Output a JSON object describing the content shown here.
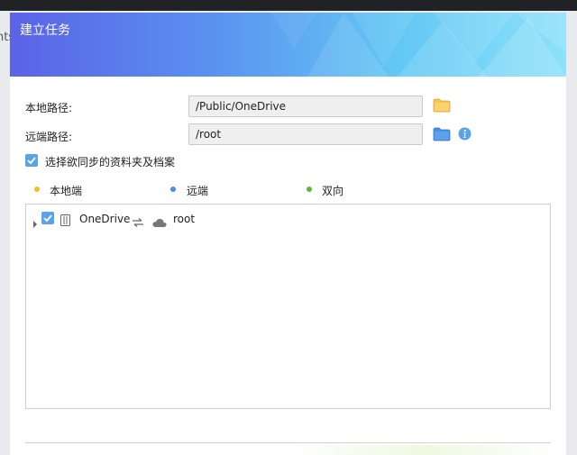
{
  "background": {
    "partial_text": "nts"
  },
  "dialog": {
    "title": "建立任务",
    "local_path": {
      "label": "本地路径:",
      "value": "/Public/OneDrive"
    },
    "remote_path": {
      "label": "远端路径:",
      "value": "/root"
    },
    "select_checkbox": {
      "label": "选择欲同步的资料夹及档案",
      "checked": true
    },
    "legend": [
      {
        "label": "本地端",
        "color": "#f0c020"
      },
      {
        "label": "远端",
        "color": "#4a90e2"
      },
      {
        "label": "双向",
        "color": "#5cb83a"
      }
    ],
    "tree": {
      "rows": [
        {
          "local_name": "OneDrive",
          "remote_name": "root",
          "checked": true,
          "sync_icon": "sync-arrows-icon"
        }
      ]
    }
  },
  "colors": {
    "accent": "#5aa2ea",
    "folder_yellow": "#f5c451",
    "folder_blue": "#4a90e2",
    "header_start": "#5b63e6",
    "header_end": "#8de1fa"
  }
}
